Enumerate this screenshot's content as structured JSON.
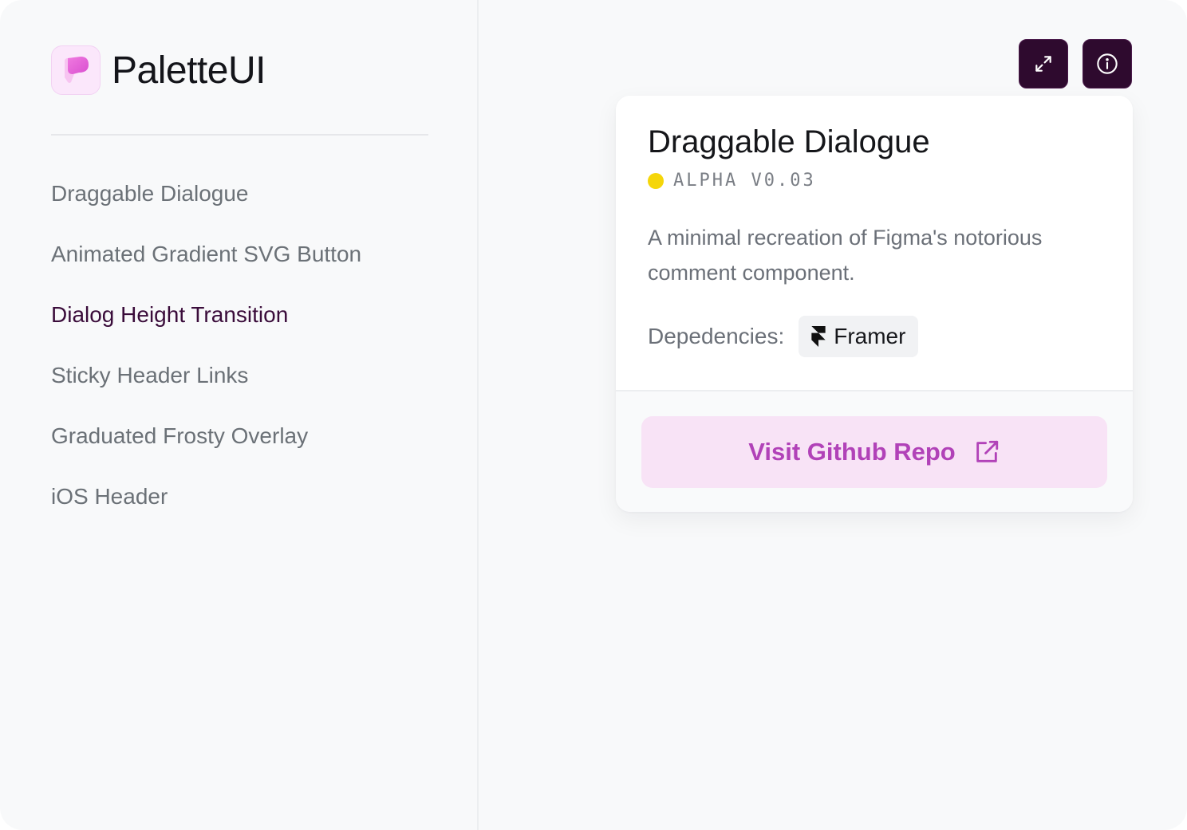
{
  "brand": {
    "name": "PaletteUI",
    "logo_icon": "palette-logo-icon",
    "logo_color": "#e86ad6"
  },
  "sidebar": {
    "items": [
      {
        "label": "Draggable Dialogue",
        "active": false
      },
      {
        "label": "Animated Gradient SVG Button",
        "active": false
      },
      {
        "label": "Dialog Height Transition",
        "active": true
      },
      {
        "label": "Sticky Header Links",
        "active": false
      },
      {
        "label": "Graduated Frosty Overlay",
        "active": false
      },
      {
        "label": "iOS Header",
        "active": false
      }
    ]
  },
  "toolbar": {
    "expand_icon": "expand-icon",
    "info_icon": "info-icon",
    "button_color": "#2e0a2e"
  },
  "card": {
    "title": "Draggable Dialogue",
    "status": "ALPHA V0.03",
    "status_color": "#f5d60a",
    "description": "A minimal recreation of Figma's notorious comment component.",
    "dependencies_label": "Depedencies:",
    "dependency": {
      "name": "Framer",
      "icon": "framer-icon"
    },
    "repo_button": {
      "label": "Visit Github Repo",
      "icon": "external-link-icon",
      "color": "#b142b8"
    }
  }
}
